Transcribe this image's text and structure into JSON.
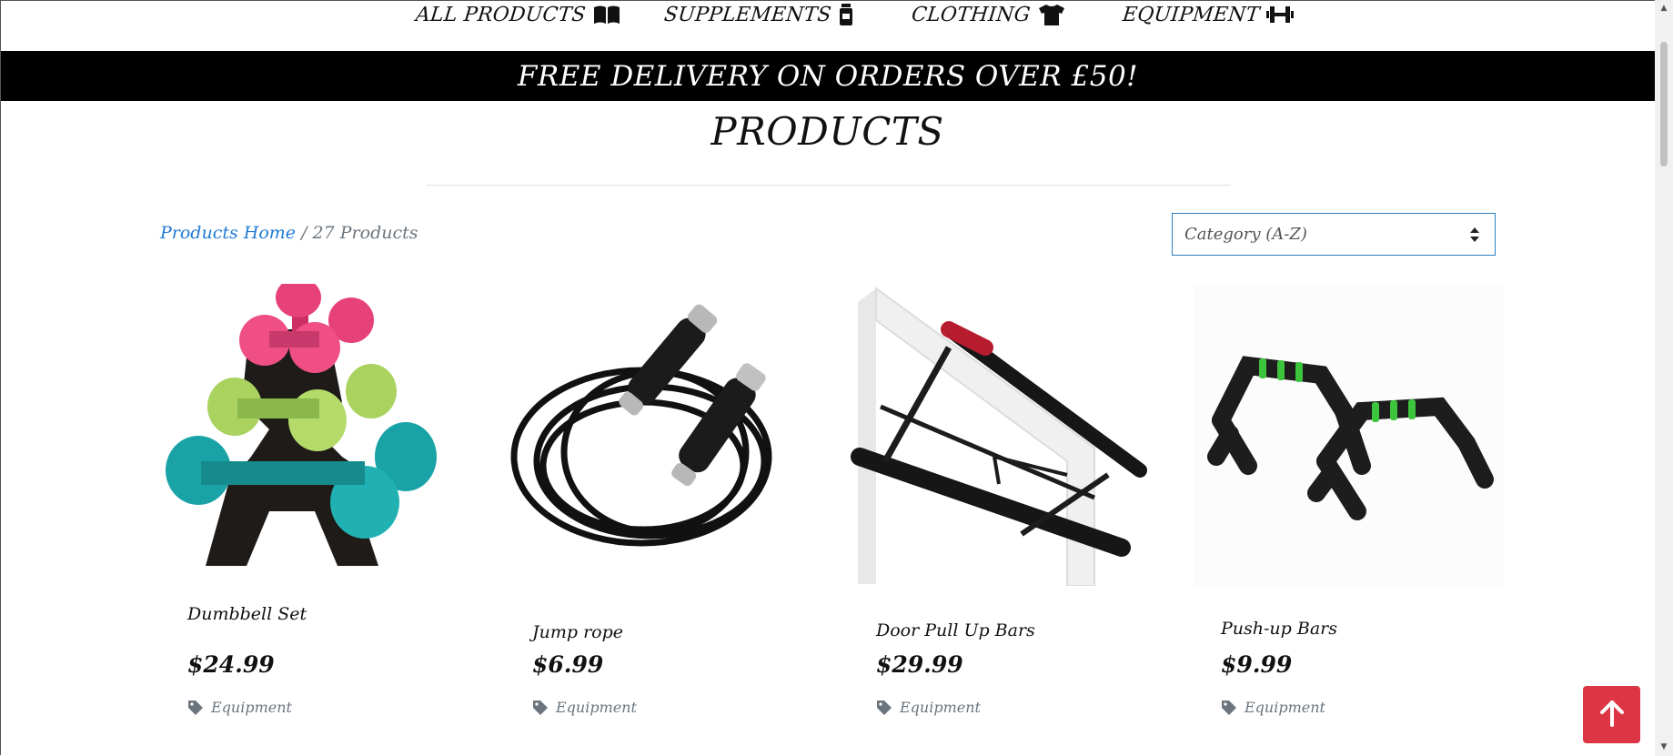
{
  "nav": {
    "items": [
      {
        "label": "ALL PRODUCTS",
        "icon": "book-open-icon"
      },
      {
        "label": "SUPPLEMENTS",
        "icon": "bottle-icon"
      },
      {
        "label": "CLOTHING",
        "icon": "tshirt-icon"
      },
      {
        "label": "EQUIPMENT",
        "icon": "dumbbell-icon"
      }
    ]
  },
  "banner": {
    "text": "FREE DELIVERY ON ORDERS OVER £50!"
  },
  "page": {
    "title": "PRODUCTS"
  },
  "breadcrumb": {
    "home_label": "Products Home",
    "separator": "/",
    "count_label": "27 Products"
  },
  "sort": {
    "selected": "Category (A-Z)"
  },
  "products": [
    {
      "name": "Dumbbell Set",
      "price": "$24.99",
      "category": "Equipment",
      "image": "dumbbell-set-image"
    },
    {
      "name": "Jump rope",
      "price": "$6.99",
      "category": "Equipment",
      "image": "jump-rope-image"
    },
    {
      "name": "Door Pull Up Bars",
      "price": "$29.99",
      "category": "Equipment",
      "image": "pull-up-bar-image"
    },
    {
      "name": "Push-up Bars",
      "price": "$9.99",
      "category": "Equipment",
      "image": "push-up-bars-image"
    }
  ],
  "colors": {
    "banner_bg": "#000000",
    "link": "#1f7ad6",
    "select_border": "#2b7fbf",
    "back_to_top": "#dc3545",
    "muted": "#6c757d"
  }
}
